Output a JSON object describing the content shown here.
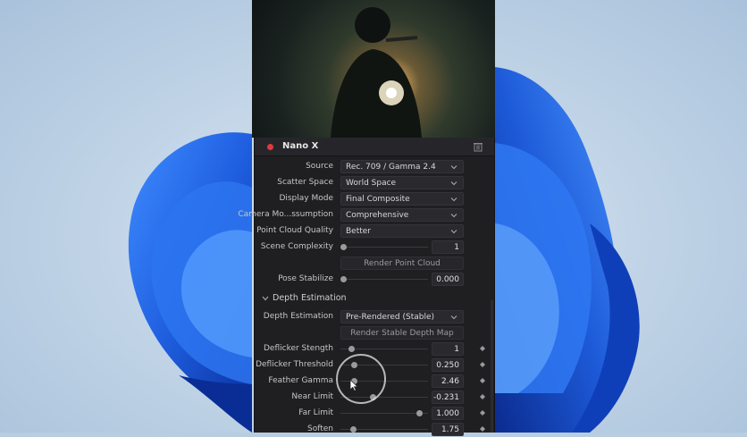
{
  "colors": {
    "accent_record": "#e03a3a",
    "panel_bg": "#1f1f22",
    "wallpaper_flower": "#1f5fe0"
  },
  "panel": {
    "title": "Nano X",
    "header_icons": [
      "record-dot-icon",
      "trash-icon"
    ]
  },
  "params": {
    "source": {
      "label": "Source",
      "value": "Rec. 709 / Gamma 2.4"
    },
    "scatter_space": {
      "label": "Scatter Space",
      "value": "World Space"
    },
    "display_mode": {
      "label": "Display Mode",
      "value": "Final Composite"
    },
    "camera_motion": {
      "label": "Camera Mo...ssumption",
      "value": "Comprehensive"
    },
    "point_cloud_quality": {
      "label": "Point Cloud Quality",
      "value": "Better"
    },
    "scene_complexity": {
      "label": "Scene Complexity",
      "value": "1",
      "level": 0.0
    },
    "render_point_cloud": {
      "label": "Render Point Cloud"
    },
    "pose_stabilize": {
      "label": "Pose Stabilize",
      "value": "0.000",
      "level": 0.0
    }
  },
  "depth": {
    "section_title": "Depth Estimation",
    "depth_estimation": {
      "label": "Depth Estimation",
      "value": "Pre-Rendered (Stable)"
    },
    "render_stable_depth_map": {
      "label": "Render Stable Depth Map"
    },
    "deflicker_strength": {
      "label": "Deflicker Stength",
      "value": "1",
      "level": 0.1
    },
    "deflicker_threshold": {
      "label": "Deflicker Threshold",
      "value": "0.250",
      "level": 0.13
    },
    "feather_gamma": {
      "label": "Feather Gamma",
      "value": "2.46",
      "level": 0.13
    },
    "near_limit": {
      "label": "Near Limit",
      "value": "-0.231",
      "level": 0.36
    },
    "far_limit": {
      "label": "Far Limit",
      "value": "1.000",
      "level": 0.93
    },
    "soften": {
      "label": "Soften",
      "value": "1.75",
      "level": 0.12
    }
  }
}
